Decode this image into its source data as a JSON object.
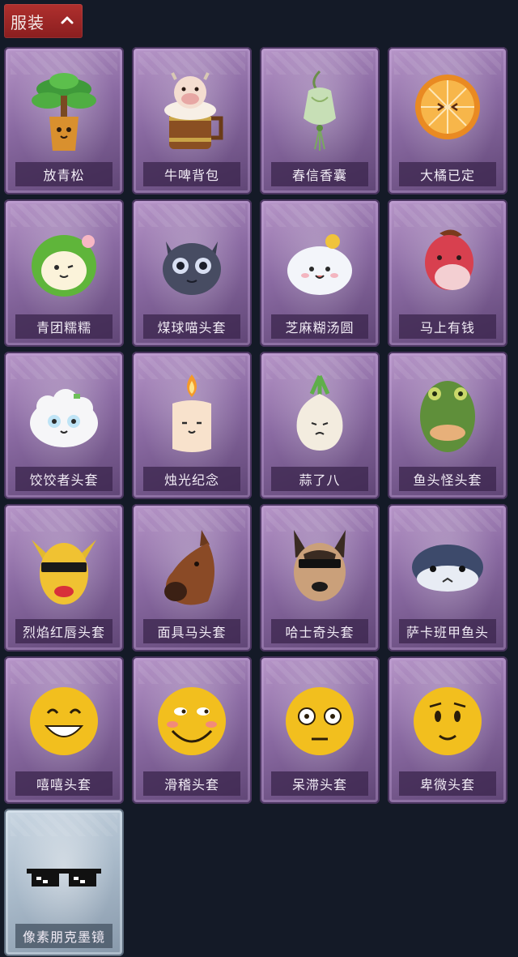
{
  "header": {
    "label": "服装",
    "chevron_icon": "chevron-up-icon"
  },
  "items": [
    {
      "label": "放青松",
      "icon": "bonsai-tree-icon",
      "theme": "purple"
    },
    {
      "label": "牛啤背包",
      "icon": "cow-beer-barrel-icon",
      "theme": "purple"
    },
    {
      "label": "春信香囊",
      "icon": "sachet-pouch-icon",
      "theme": "purple"
    },
    {
      "label": "大橘已定",
      "icon": "orange-slice-icon",
      "theme": "purple"
    },
    {
      "label": "青团糯糯",
      "icon": "green-dumpling-icon",
      "theme": "purple"
    },
    {
      "label": "煤球喵头套",
      "icon": "black-cat-head-icon",
      "theme": "purple"
    },
    {
      "label": "芝麻糊汤圆",
      "icon": "rice-ball-icon",
      "theme": "purple"
    },
    {
      "label": "马上有钱",
      "icon": "red-horse-head-icon",
      "theme": "purple"
    },
    {
      "label": "饺饺者头套",
      "icon": "dumpling-head-icon",
      "theme": "purple"
    },
    {
      "label": "烛光纪念",
      "icon": "candle-icon",
      "theme": "purple"
    },
    {
      "label": "蒜了八",
      "icon": "garlic-icon",
      "theme": "purple"
    },
    {
      "label": "鱼头怪头套",
      "icon": "fish-head-icon",
      "theme": "purple"
    },
    {
      "label": "烈焰红唇头套",
      "icon": "yellow-mask-icon",
      "theme": "purple"
    },
    {
      "label": "面具马头套",
      "icon": "horse-mask-icon",
      "theme": "purple"
    },
    {
      "label": "哈士奇头套",
      "icon": "husky-mask-icon",
      "theme": "purple"
    },
    {
      "label": "萨卡班甲鱼头",
      "icon": "sacabambaspis-icon",
      "theme": "purple"
    },
    {
      "label": "嘻嘻头套",
      "icon": "grin-emoji-icon",
      "theme": "purple"
    },
    {
      "label": "滑稽头套",
      "icon": "funny-emoji-icon",
      "theme": "purple"
    },
    {
      "label": "呆滞头套",
      "icon": "dazed-emoji-icon",
      "theme": "purple"
    },
    {
      "label": "卑微头套",
      "icon": "humble-emoji-icon",
      "theme": "purple"
    },
    {
      "label": "像素朋克墨镜",
      "icon": "pixel-sunglasses-icon",
      "theme": "pale"
    }
  ]
}
